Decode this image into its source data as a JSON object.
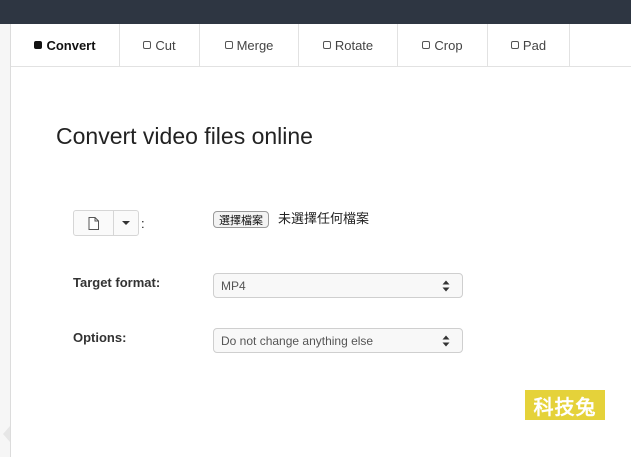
{
  "tabs": [
    {
      "label": "Convert",
      "active": true
    },
    {
      "label": "Cut",
      "active": false
    },
    {
      "label": "Merge",
      "active": false
    },
    {
      "label": "Rotate",
      "active": false
    },
    {
      "label": "Crop",
      "active": false
    },
    {
      "label": "Pad",
      "active": false
    }
  ],
  "main": {
    "heading": "Convert video files online",
    "source": {
      "colon": ":",
      "file_button_label": "選擇檔案",
      "file_status": "未選擇任何檔案",
      "source_icon": "file-icon",
      "dropdown_icon": "caret-down-icon"
    },
    "target_format": {
      "label": "Target format:",
      "value": "MP4"
    },
    "options": {
      "label": "Options:",
      "value": "Do not change anything else"
    }
  },
  "watermark": {
    "text": "科技兔",
    "color": "#e5d23a"
  },
  "colors": {
    "topbar": "#2e3642",
    "panel": "#ffffff",
    "background": "#f6f6f6"
  }
}
